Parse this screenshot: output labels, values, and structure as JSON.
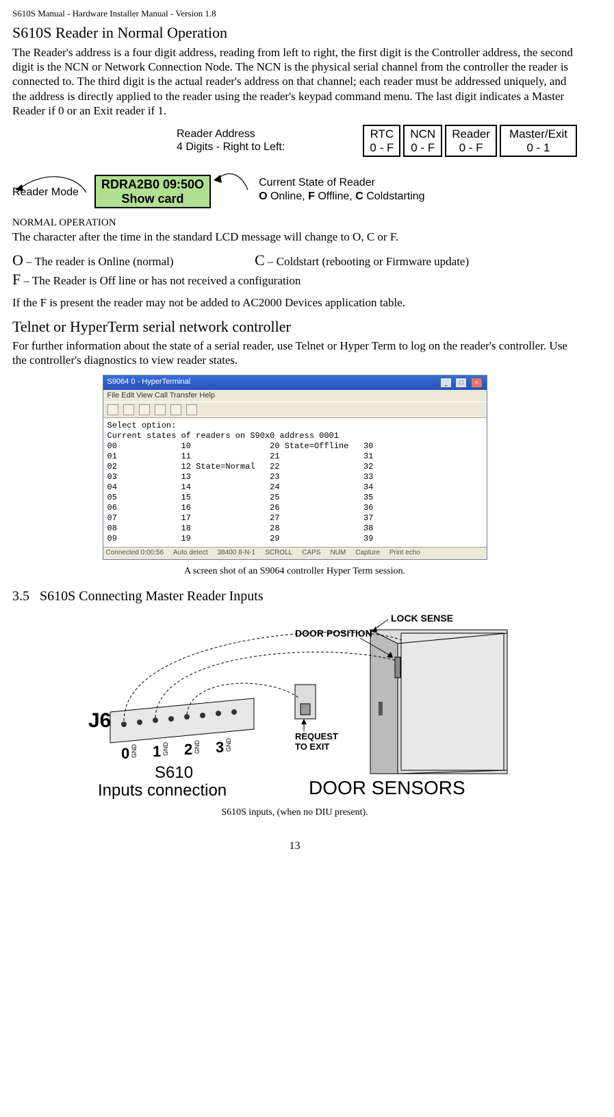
{
  "header": "S610S Manual  - Hardware Installer Manual  - Version 1.8",
  "title1": "S610S Reader in Normal Operation",
  "intro": "The Reader's address is a four digit address, reading from left to right, the first digit is the Controller address, the second digit is the NCN or Network Connection Node.  The NCN is the physical serial channel from the controller the reader is connected to.  The third digit is the actual reader's address on that channel; each reader must be addressed uniquely, and the address is directly applied to the reader using the reader's keypad command menu.  The last digit indicates a Master Reader if 0 or an Exit reader if 1.",
  "diag1": {
    "addr_label_l1": "Reader Address",
    "addr_label_l2": "4 Digits - Right to Left:",
    "boxes": [
      {
        "top": "RTC",
        "bot": "0 - F"
      },
      {
        "top": "NCN",
        "bot": "0 - F"
      },
      {
        "top": "Reader",
        "bot": "0 - F"
      },
      {
        "top": "Master/Exit",
        "bot": "0 - 1"
      }
    ],
    "reader_mode": "Reader Mode",
    "lcd_l1": "RDRA2B0    09:50O",
    "lcd_l2": "Show card",
    "state_l1": "Current State of Reader",
    "state_l2_O": "O",
    "state_l2_O_t": " Online,  ",
    "state_l2_F": "F",
    "state_l2_F_t": " Offline,  ",
    "state_l2_C": "C",
    "state_l2_C_t": " Coldstarting"
  },
  "normal_op_head": "NORMAL OPERATION",
  "normal_op_text": "The character after the time in the standard LCD message will change to O, C or F.",
  "O_line_letter": "O",
  "O_line_text": " – The reader is Online (normal)",
  "C_line_letter": "C",
  "C_line_text": " – Coldstart (rebooting or Firmware update)",
  "F_line_letter": "F",
  "F_line_text": " –  The Reader is Off line or has not received a configuration",
  "f_present": "If the F is present the reader may not be added to AC2000 Devices application table.",
  "title2": "Telnet or HyperTerm serial network controller",
  "telnet_para": "For further information about the state of a serial reader, use Telnet or Hyper Term to log on the reader's controller.  Use the controller's diagnostics to view reader states.",
  "ht": {
    "title": "S9064 0 - HyperTerminal",
    "menu": "File  Edit  View  Call  Transfer  Help",
    "body": "Select option:\nCurrent states of readers on S90x0 address 0001\n00             10                20 State=Offline   30\n01             11                21                 31\n02             12 State=Normal   22                 32\n03             13                23                 33\n04             14                24                 34\n05             15                25                 35\n06             16                26                 36\n07             17                27                 37\n08             18                28                 38\n09             19                29                 39",
    "status": [
      "Connected 0:00:56",
      "Auto detect",
      "38400 8-N-1",
      "SCROLL",
      "CAPS",
      "NUM",
      "Capture",
      "Print echo"
    ]
  },
  "caption1": "A screen shot of an S9064 controller Hyper Term session.",
  "sec35_num": "3.5",
  "sec35_title": "S610S Connecting Master Reader Inputs",
  "door": {
    "lock_sense": "LOCK  SENSE",
    "door_pos": "DOOR POSITION",
    "rte_l1": "REQUEST",
    "rte_l2": "TO EXIT",
    "j6": "J6",
    "nums": [
      "0",
      "1",
      "2",
      "3"
    ],
    "gnd": "GND",
    "s610": "S610",
    "inputs_conn": "Inputs connection",
    "door_sensors": "DOOR SENSORS"
  },
  "caption2": "S610S inputs, (when no DIU present).",
  "page_num": "13"
}
